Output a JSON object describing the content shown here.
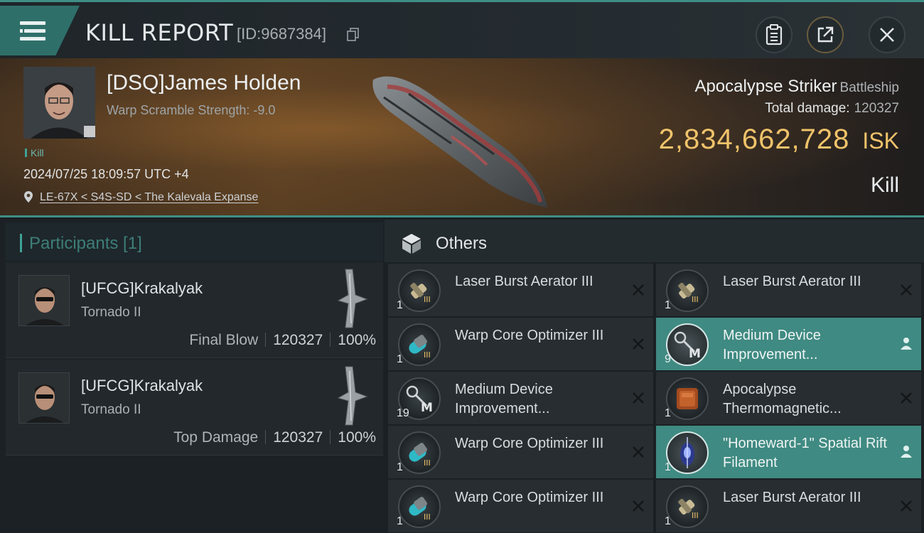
{
  "header": {
    "title": "KILL REPORT",
    "id_label": "[ID:9687384]"
  },
  "victim": {
    "name": "[DSQ]James Holden",
    "warp_scramble": "Warp Scramble Strength: -9.0",
    "tag": "Kill",
    "timestamp": "2024/07/25 18:09:57 UTC +4",
    "location": "LE-67X < S4S-SD < The Kalevala Expanse",
    "ship": "Apocalypse Striker",
    "ship_class": "Battleship",
    "total_damage_label": "Total damage:",
    "total_damage": "120327",
    "isk_value": "2,834,662,728",
    "isk_unit": "ISK",
    "result": "Kill"
  },
  "participants": {
    "title": "Participants [1]",
    "rows": [
      {
        "name": "[UFCG]Krakalyak",
        "ship": "Tornado II",
        "label": "Final Blow",
        "damage": "120327",
        "percent": "100%"
      },
      {
        "name": "[UFCG]Krakalyak",
        "ship": "Tornado II",
        "label": "Top Damage",
        "damage": "120327",
        "percent": "100%"
      }
    ]
  },
  "items": {
    "title": "Others",
    "list": [
      {
        "name": "Laser Burst Aerator III",
        "qty": "1",
        "highlight": false,
        "icon": "laser-icon"
      },
      {
        "name": "Laser Burst Aerator III",
        "qty": "1",
        "highlight": false,
        "icon": "laser-icon"
      },
      {
        "name": "Warp Core Optimizer III",
        "qty": "1",
        "highlight": false,
        "icon": "warp-core-icon"
      },
      {
        "name": "Medium Device Improvement...",
        "qty": "9",
        "highlight": true,
        "icon": "device-icon"
      },
      {
        "name": "Medium Device Improvement...",
        "qty": "19",
        "highlight": false,
        "icon": "device-icon"
      },
      {
        "name": "Apocalypse Thermomagnetic...",
        "qty": "1",
        "highlight": false,
        "icon": "armor-plate-icon"
      },
      {
        "name": "Warp Core Optimizer III",
        "qty": "1",
        "highlight": false,
        "icon": "warp-core-icon"
      },
      {
        "name": "\"Homeward-1\" Spatial Rift Filament",
        "qty": "1",
        "highlight": true,
        "icon": "filament-icon"
      },
      {
        "name": "Warp Core Optimizer III",
        "qty": "1",
        "highlight": false,
        "icon": "warp-core-icon"
      },
      {
        "name": "Laser Burst Aerator III",
        "qty": "1",
        "highlight": false,
        "icon": "laser-icon"
      }
    ]
  },
  "colors": {
    "accent_teal": "#3f8a82",
    "isk_gold": "#f0c36a"
  }
}
